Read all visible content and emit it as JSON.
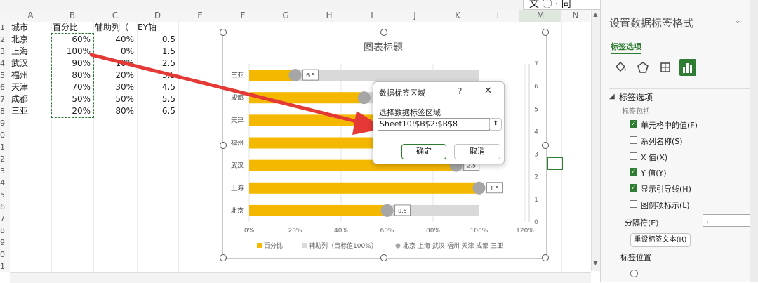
{
  "sheet": {
    "columns": [
      "A",
      "B",
      "C",
      "D",
      "E",
      "F",
      "G",
      "H",
      "I",
      "J",
      "K",
      "L",
      "M",
      "N"
    ],
    "rows": [
      "1",
      "2",
      "3",
      "4",
      "5",
      "6",
      "7",
      "8",
      "9",
      "0",
      "1",
      "2",
      "3",
      "4",
      "5",
      "6",
      "7",
      "8",
      "9",
      "0",
      "1"
    ],
    "headers": [
      "城市",
      "百分比",
      "辅助列（",
      "EY轴"
    ],
    "data": [
      {
        "city": "北京",
        "pct": "60%",
        "aux": "40%",
        "y": "0.5"
      },
      {
        "city": "上海",
        "pct": "100%",
        "aux": "0%",
        "y": "1.5"
      },
      {
        "city": "武汉",
        "pct": "90%",
        "aux": "10%",
        "y": "2.5"
      },
      {
        "city": "福州",
        "pct": "80%",
        "aux": "20%",
        "y": "3.5"
      },
      {
        "city": "天津",
        "pct": "70%",
        "aux": "30%",
        "y": "4.5"
      },
      {
        "city": "成都",
        "pct": "50%",
        "aux": "50%",
        "y": "5.5"
      },
      {
        "city": "三亚",
        "pct": "20%",
        "aux": "80%",
        "y": "6.5"
      }
    ]
  },
  "top_overlay": {
    "text": "文 ⓘ · 同 "
  },
  "chart_data": {
    "type": "bar",
    "title": "图表标题",
    "categories": [
      "北京",
      "上海",
      "武汉",
      "福州",
      "天津",
      "成都",
      "三亚"
    ],
    "series": [
      {
        "name": "百分比",
        "values": [
          60,
          100,
          90,
          80,
          70,
          50,
          20
        ],
        "color": "#f5b800"
      },
      {
        "name": "辅助列（目标值100%）",
        "values": [
          40,
          0,
          10,
          20,
          30,
          50,
          80
        ],
        "color": "#d9d9d9"
      }
    ],
    "scatter": {
      "name": "北京 上海 武汉 福州 天津 成都 三亚",
      "x": [
        60,
        100,
        90,
        80,
        70,
        50,
        20
      ],
      "y": [
        0.5,
        1.5,
        2.5,
        3.5,
        4.5,
        5.5,
        6.5
      ],
      "color": "#a6a6a6"
    },
    "data_labels": [
      "0.5",
      "1.5",
      "2.5",
      "",
      "",
      "",
      "6.5"
    ],
    "xticks": [
      "0%",
      "20%",
      "40%",
      "60%",
      "80%",
      "100%",
      "120%"
    ],
    "xlim": [
      0,
      120
    ],
    "y2ticks": [
      "0",
      "1",
      "2",
      "3",
      "4",
      "5",
      "6",
      "7"
    ],
    "y2lim": [
      0,
      7
    ],
    "legend_position": "bottom"
  },
  "dialog": {
    "title": "数据标签区域",
    "help": "?",
    "close": "✕",
    "label": "选择数据标签区域",
    "value": "Sheet10!$B$2:$B$8",
    "ok": "确定",
    "cancel": "取消"
  },
  "pane": {
    "title": "设置数据标签格式",
    "tab": "标签选项",
    "section": "标签选项",
    "contains": "标签包括",
    "options": [
      {
        "label": "单元格中的值(F)",
        "checked": true
      },
      {
        "label": "系列名称(S)",
        "checked": false
      },
      {
        "label": "X 值(X)",
        "checked": false
      },
      {
        "label": "Y 值(Y)",
        "checked": true
      },
      {
        "label": "显示引导线(H)",
        "checked": true
      },
      {
        "label": "图例项标示(L)",
        "checked": false
      }
    ],
    "separator_label": "分隔符(E)",
    "separator_value": ",",
    "reset_button": "重设标签文本(R)",
    "position_label": "标签位置"
  },
  "colors": {
    "accent": "#2e7d32",
    "highlight": "#e53935",
    "bar": "#f5b800",
    "aux": "#d9d9d9"
  }
}
